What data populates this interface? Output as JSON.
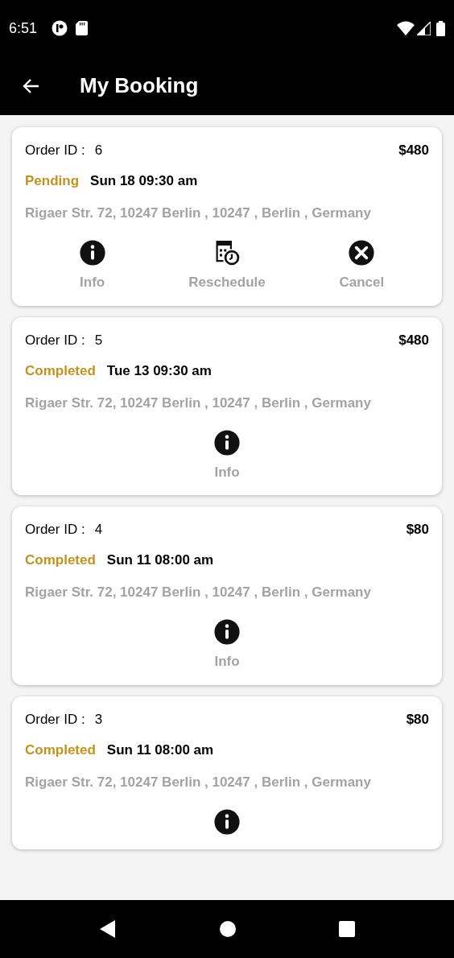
{
  "status_bar": {
    "time": "6:51"
  },
  "app_bar": {
    "title": "My Booking"
  },
  "bookings": [
    {
      "order_label": "Order ID :",
      "order_id": "6",
      "price": "$480",
      "status": "Pending",
      "date": "Sun 18 09:30 am",
      "address": "Rigaer Str. 72, 10247  Berlin , 10247 , Berlin , Germany",
      "actions": [
        {
          "kind": "info",
          "label": "Info"
        },
        {
          "kind": "reschedule",
          "label": "Reschedule"
        },
        {
          "kind": "cancel",
          "label": "Cancel"
        }
      ]
    },
    {
      "order_label": "Order ID :",
      "order_id": "5",
      "price": "$480",
      "status": "Completed",
      "date": "Tue 13 09:30 am",
      "address": "Rigaer Str. 72, 10247  Berlin , 10247 , Berlin , Germany",
      "actions": [
        {
          "kind": "info",
          "label": "Info"
        }
      ]
    },
    {
      "order_label": "Order ID :",
      "order_id": "4",
      "price": "$80",
      "status": "Completed",
      "date": "Sun 11 08:00 am",
      "address": "Rigaer Str. 72, 10247  Berlin , 10247 , Berlin , Germany",
      "actions": [
        {
          "kind": "info",
          "label": "Info"
        }
      ]
    },
    {
      "order_label": "Order ID :",
      "order_id": "3",
      "price": "$80",
      "status": "Completed",
      "date": "Sun 11 08:00 am",
      "address": "Rigaer Str. 72, 10247  Berlin , 10247 , Berlin , Germany",
      "actions": [
        {
          "kind": "info"
        }
      ]
    }
  ]
}
